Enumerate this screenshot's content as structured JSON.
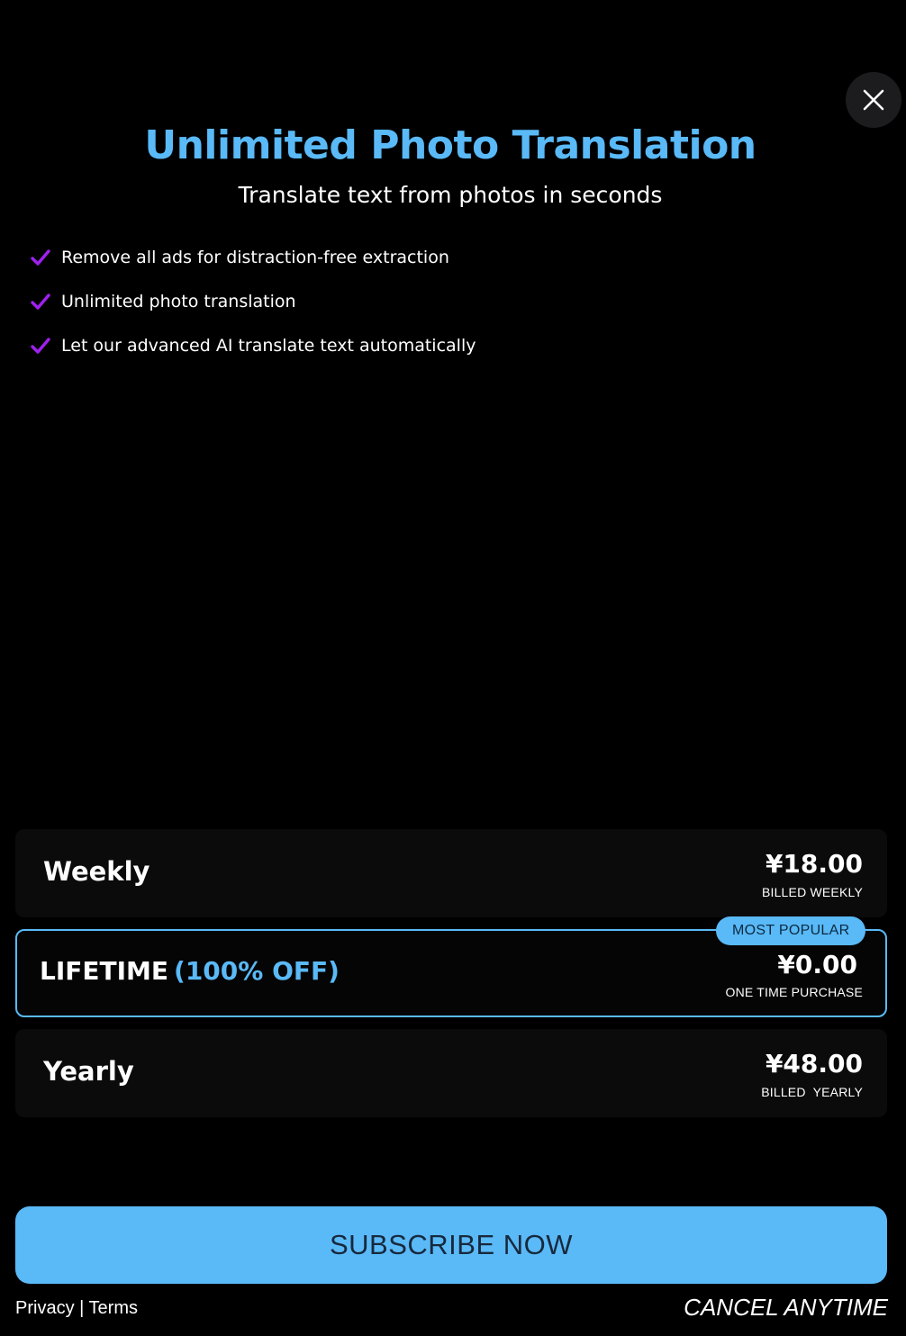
{
  "header": {
    "title": "Unlimited Photo Translation",
    "subtitle": "Translate text from photos in seconds"
  },
  "features": [
    "Remove all ads for distraction-free extraction",
    "Unlimited photo translation",
    "Let our advanced AI translate text automatically"
  ],
  "plans": {
    "weekly": {
      "name": "Weekly",
      "price": "¥18.00",
      "billing": "BILLED WEEKLY"
    },
    "lifetime": {
      "name": "LIFETIME",
      "discount": "(100% OFF)",
      "badge": "MOST POPULAR",
      "price": "¥0.00",
      "billing": "ONE TIME PURCHASE",
      "selected": true
    },
    "yearly": {
      "name": "Yearly",
      "price": "¥48.00",
      "billing": "BILLED  YEARLY"
    }
  },
  "cta": {
    "label": "SUBSCRIBE NOW"
  },
  "footer": {
    "privacy": "Privacy",
    "separator": " | ",
    "terms": "Terms",
    "cancel": "CANCEL ANYTIME"
  },
  "icons": {
    "close": "close-icon",
    "check": "check-icon"
  },
  "colors": {
    "accent": "#5ab9f7",
    "check": "#a020f0",
    "background": "#000000"
  }
}
